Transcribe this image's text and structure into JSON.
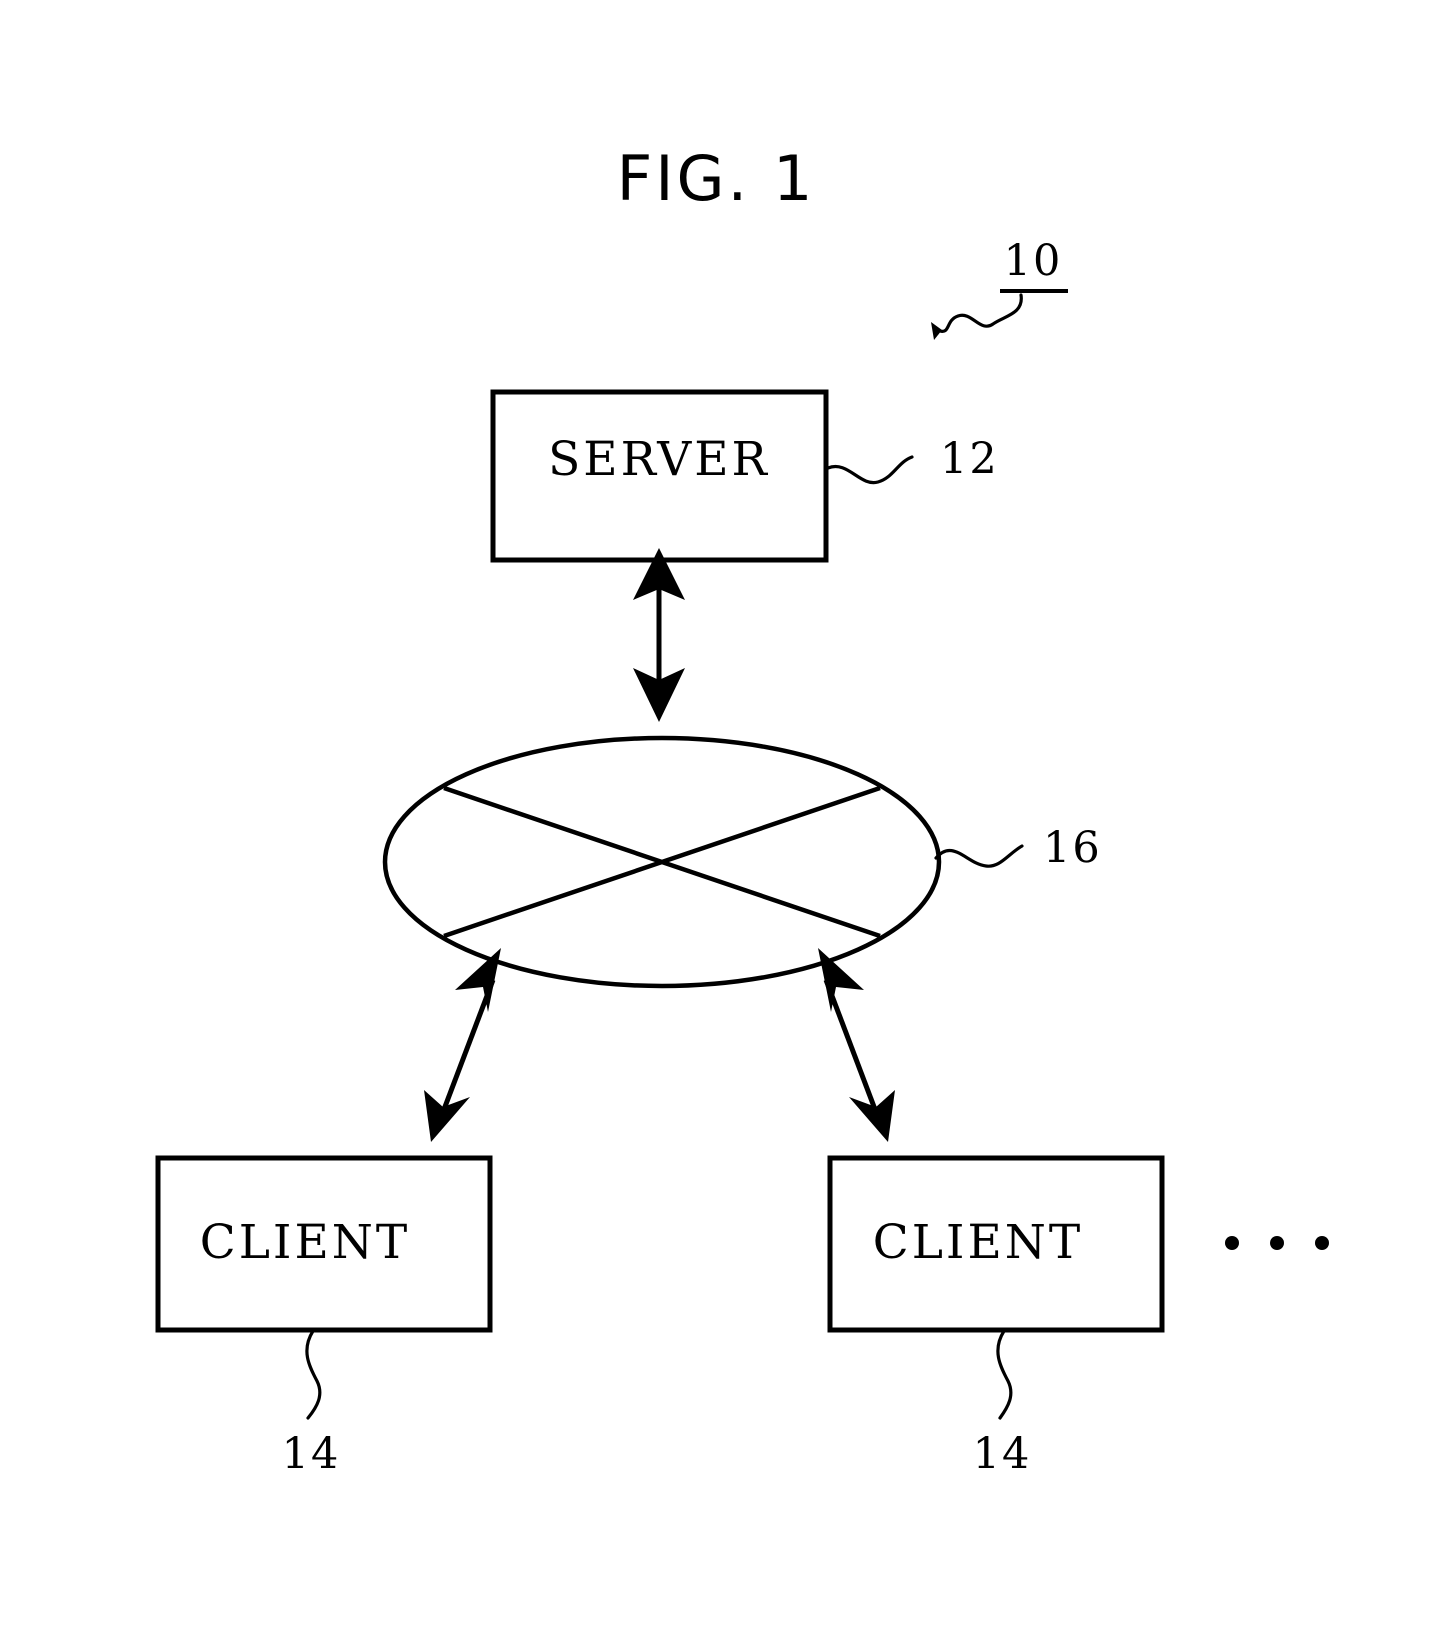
{
  "figure": {
    "title": "FIG. 1",
    "type": "patent-diagram",
    "description": "Client-server system block diagram"
  },
  "nodes": {
    "server": {
      "label": "SERVER",
      "ref": "12"
    },
    "network": {
      "label": "",
      "ref": "16",
      "shape": "ellipse-with-x"
    },
    "client_left": {
      "label": "CLIENT",
      "ref": "14"
    },
    "client_right": {
      "label": "CLIENT",
      "ref": "14"
    }
  },
  "system": {
    "ref": "10"
  },
  "ellipsis": {
    "dots": "• • •",
    "count": 3
  },
  "colors": {
    "line": "#000000",
    "background": "#ffffff",
    "fill": "#ffffff"
  }
}
